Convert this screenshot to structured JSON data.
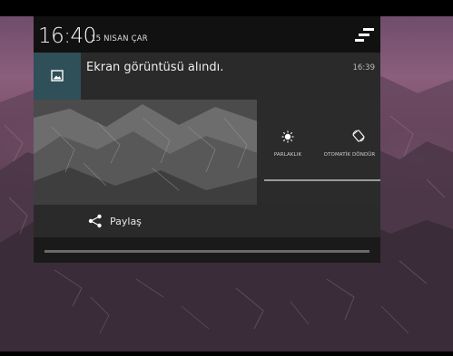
{
  "status": {
    "time": "16:40",
    "date": "15 NISAN ÇAR"
  },
  "notification": {
    "title": "Ekran görüntüsü alındı.",
    "time": "16:39",
    "icon": "image-icon"
  },
  "quick_settings": {
    "tiles": [
      {
        "label": "PARLAKLIK",
        "icon": "brightness-icon"
      },
      {
        "label": "OTOMATİK DÖNDÜR",
        "icon": "auto-rotate-icon"
      }
    ]
  },
  "actions": {
    "share_label": "Paylaş",
    "share_icon": "share-icon"
  },
  "colors": {
    "notif_icon_bg": "#2f4f59",
    "shade_bg": "#2a2a2a"
  }
}
